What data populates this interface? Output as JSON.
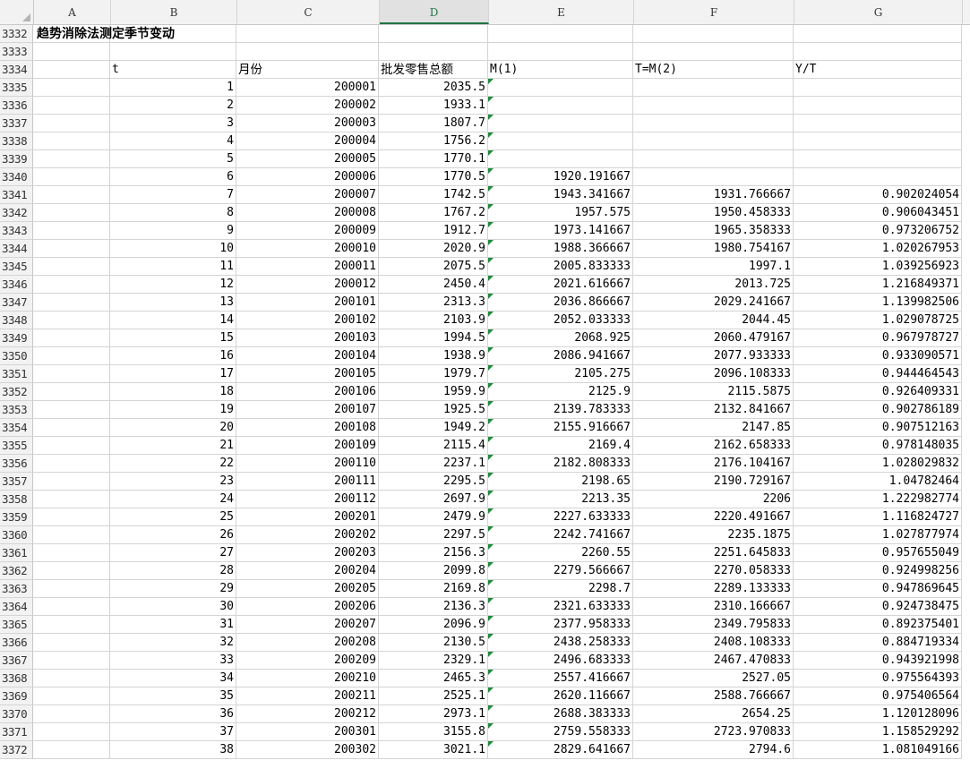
{
  "columns": [
    "A",
    "B",
    "C",
    "D",
    "E",
    "F",
    "G"
  ],
  "selected_column": "D",
  "title_row": {
    "row": "3332",
    "title": "趋势消除法测定季节变动"
  },
  "blank_row": {
    "row": "3333"
  },
  "header_row": {
    "row": "3334",
    "B": "t",
    "C": "月份",
    "D": "批发零售总额",
    "E": "M(1)",
    "F": "T=M(2)",
    "G": "Y/T"
  },
  "rows": [
    {
      "r": "3335",
      "t": "1",
      "m": "200001",
      "v": "2035.5",
      "e": "",
      "f": "",
      "g": ""
    },
    {
      "r": "3336",
      "t": "2",
      "m": "200002",
      "v": "1933.1",
      "e": "",
      "f": "",
      "g": ""
    },
    {
      "r": "3337",
      "t": "3",
      "m": "200003",
      "v": "1807.7",
      "e": "",
      "f": "",
      "g": ""
    },
    {
      "r": "3338",
      "t": "4",
      "m": "200004",
      "v": "1756.2",
      "e": "",
      "f": "",
      "g": ""
    },
    {
      "r": "3339",
      "t": "5",
      "m": "200005",
      "v": "1770.1",
      "e": "",
      "f": "",
      "g": ""
    },
    {
      "r": "3340",
      "t": "6",
      "m": "200006",
      "v": "1770.5",
      "e": "1920.191667",
      "f": "",
      "g": ""
    },
    {
      "r": "3341",
      "t": "7",
      "m": "200007",
      "v": "1742.5",
      "e": "1943.341667",
      "f": "1931.766667",
      "g": "0.902024054"
    },
    {
      "r": "3342",
      "t": "8",
      "m": "200008",
      "v": "1767.2",
      "e": "1957.575",
      "f": "1950.458333",
      "g": "0.906043451"
    },
    {
      "r": "3343",
      "t": "9",
      "m": "200009",
      "v": "1912.7",
      "e": "1973.141667",
      "f": "1965.358333",
      "g": "0.973206752"
    },
    {
      "r": "3344",
      "t": "10",
      "m": "200010",
      "v": "2020.9",
      "e": "1988.366667",
      "f": "1980.754167",
      "g": "1.020267953"
    },
    {
      "r": "3345",
      "t": "11",
      "m": "200011",
      "v": "2075.5",
      "e": "2005.833333",
      "f": "1997.1",
      "g": "1.039256923"
    },
    {
      "r": "3346",
      "t": "12",
      "m": "200012",
      "v": "2450.4",
      "e": "2021.616667",
      "f": "2013.725",
      "g": "1.216849371"
    },
    {
      "r": "3347",
      "t": "13",
      "m": "200101",
      "v": "2313.3",
      "e": "2036.866667",
      "f": "2029.241667",
      "g": "1.139982506"
    },
    {
      "r": "3348",
      "t": "14",
      "m": "200102",
      "v": "2103.9",
      "e": "2052.033333",
      "f": "2044.45",
      "g": "1.029078725"
    },
    {
      "r": "3349",
      "t": "15",
      "m": "200103",
      "v": "1994.5",
      "e": "2068.925",
      "f": "2060.479167",
      "g": "0.967978727"
    },
    {
      "r": "3350",
      "t": "16",
      "m": "200104",
      "v": "1938.9",
      "e": "2086.941667",
      "f": "2077.933333",
      "g": "0.933090571"
    },
    {
      "r": "3351",
      "t": "17",
      "m": "200105",
      "v": "1979.7",
      "e": "2105.275",
      "f": "2096.108333",
      "g": "0.944464543"
    },
    {
      "r": "3352",
      "t": "18",
      "m": "200106",
      "v": "1959.9",
      "e": "2125.9",
      "f": "2115.5875",
      "g": "0.926409331"
    },
    {
      "r": "3353",
      "t": "19",
      "m": "200107",
      "v": "1925.5",
      "e": "2139.783333",
      "f": "2132.841667",
      "g": "0.902786189"
    },
    {
      "r": "3354",
      "t": "20",
      "m": "200108",
      "v": "1949.2",
      "e": "2155.916667",
      "f": "2147.85",
      "g": "0.907512163"
    },
    {
      "r": "3355",
      "t": "21",
      "m": "200109",
      "v": "2115.4",
      "e": "2169.4",
      "f": "2162.658333",
      "g": "0.978148035"
    },
    {
      "r": "3356",
      "t": "22",
      "m": "200110",
      "v": "2237.1",
      "e": "2182.808333",
      "f": "2176.104167",
      "g": "1.028029832"
    },
    {
      "r": "3357",
      "t": "23",
      "m": "200111",
      "v": "2295.5",
      "e": "2198.65",
      "f": "2190.729167",
      "g": "1.04782464"
    },
    {
      "r": "3358",
      "t": "24",
      "m": "200112",
      "v": "2697.9",
      "e": "2213.35",
      "f": "2206",
      "g": "1.222982774"
    },
    {
      "r": "3359",
      "t": "25",
      "m": "200201",
      "v": "2479.9",
      "e": "2227.633333",
      "f": "2220.491667",
      "g": "1.116824727"
    },
    {
      "r": "3360",
      "t": "26",
      "m": "200202",
      "v": "2297.5",
      "e": "2242.741667",
      "f": "2235.1875",
      "g": "1.027877974"
    },
    {
      "r": "3361",
      "t": "27",
      "m": "200203",
      "v": "2156.3",
      "e": "2260.55",
      "f": "2251.645833",
      "g": "0.957655049"
    },
    {
      "r": "3362",
      "t": "28",
      "m": "200204",
      "v": "2099.8",
      "e": "2279.566667",
      "f": "2270.058333",
      "g": "0.924998256"
    },
    {
      "r": "3363",
      "t": "29",
      "m": "200205",
      "v": "2169.8",
      "e": "2298.7",
      "f": "2289.133333",
      "g": "0.947869645"
    },
    {
      "r": "3364",
      "t": "30",
      "m": "200206",
      "v": "2136.3",
      "e": "2321.633333",
      "f": "2310.166667",
      "g": "0.924738475"
    },
    {
      "r": "3365",
      "t": "31",
      "m": "200207",
      "v": "2096.9",
      "e": "2377.958333",
      "f": "2349.795833",
      "g": "0.892375401"
    },
    {
      "r": "3366",
      "t": "32",
      "m": "200208",
      "v": "2130.5",
      "e": "2438.258333",
      "f": "2408.108333",
      "g": "0.884719334"
    },
    {
      "r": "3367",
      "t": "33",
      "m": "200209",
      "v": "2329.1",
      "e": "2496.683333",
      "f": "2467.470833",
      "g": "0.943921998"
    },
    {
      "r": "3368",
      "t": "34",
      "m": "200210",
      "v": "2465.3",
      "e": "2557.416667",
      "f": "2527.05",
      "g": "0.975564393"
    },
    {
      "r": "3369",
      "t": "35",
      "m": "200211",
      "v": "2525.1",
      "e": "2620.116667",
      "f": "2588.766667",
      "g": "0.975406564"
    },
    {
      "r": "3370",
      "t": "36",
      "m": "200212",
      "v": "2973.1",
      "e": "2688.383333",
      "f": "2654.25",
      "g": "1.120128096"
    },
    {
      "r": "3371",
      "t": "37",
      "m": "200301",
      "v": "3155.8",
      "e": "2759.558333",
      "f": "2723.970833",
      "g": "1.158529292"
    },
    {
      "r": "3372",
      "t": "38",
      "m": "200302",
      "v": "3021.1",
      "e": "2829.641667",
      "f": "2794.6",
      "g": "1.081049166"
    }
  ]
}
